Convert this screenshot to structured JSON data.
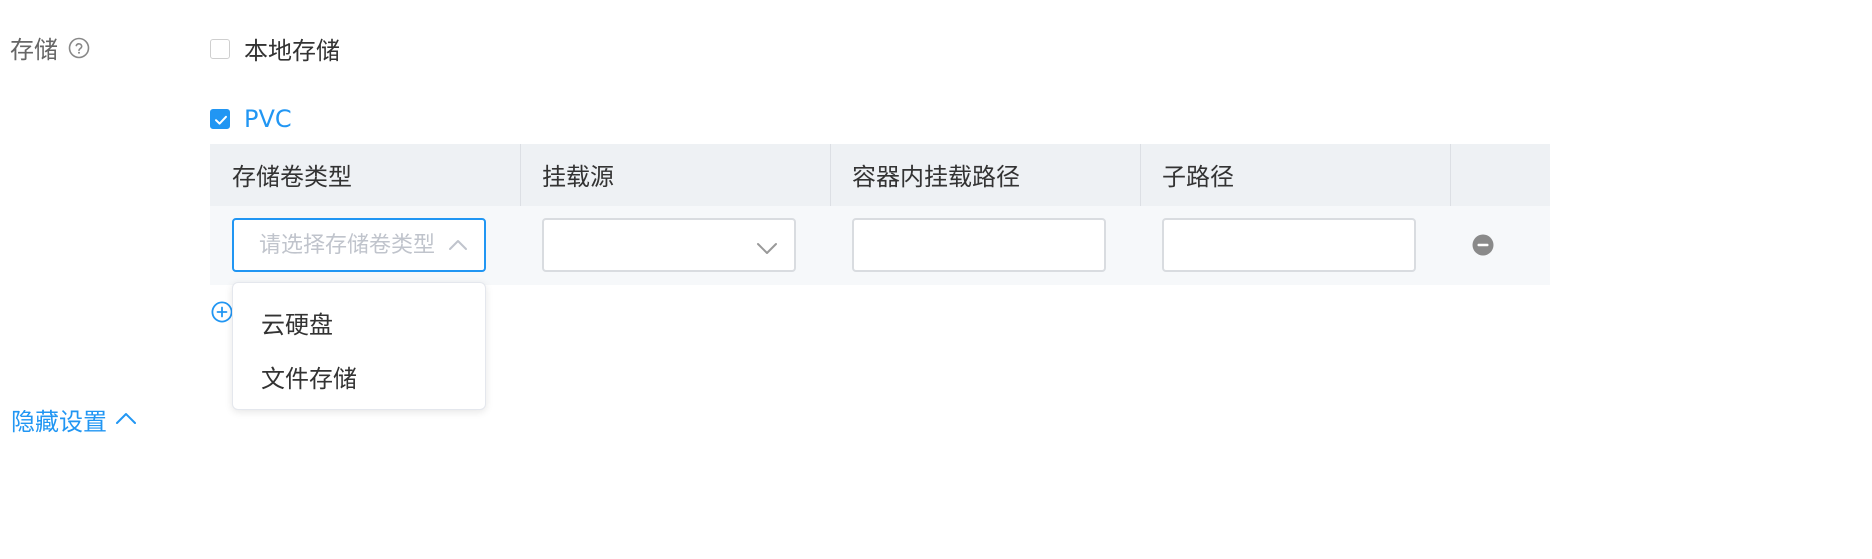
{
  "storage": {
    "label": "存储",
    "help_icon": "question-circle-icon",
    "local_option": {
      "label": "本地存储",
      "checked": false
    },
    "pvc_option": {
      "label": "PVC",
      "checked": true
    }
  },
  "volume_table": {
    "columns": [
      "存储卷类型",
      "挂载源",
      "容器内挂载路径",
      "子路径"
    ],
    "row": {
      "volume_type": {
        "value": "",
        "placeholder": "请选择存储卷类型",
        "focused": true,
        "open": true
      },
      "mount_source": {
        "value": ""
      },
      "container_path": {
        "value": ""
      },
      "sub_path": {
        "value": ""
      },
      "remove_icon": "minus-circle-icon"
    },
    "add_icon": "plus-circle-icon"
  },
  "volume_type_dropdown": {
    "options": [
      "云硬盘",
      "文件存储"
    ]
  },
  "settings_toggle": {
    "label": "隐藏设置",
    "icon": "chevron-up-icon"
  },
  "colors": {
    "accent": "#2196F3",
    "header_bg": "#EEF1F4",
    "row_bg": "#F6F8FA",
    "muted_text": "#666666"
  }
}
